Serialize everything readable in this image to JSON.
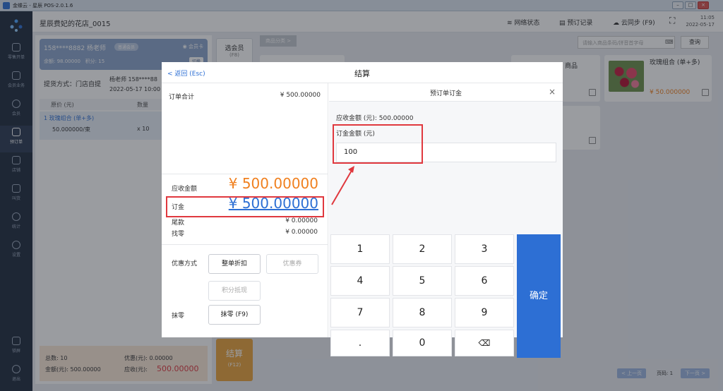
{
  "window": {
    "title": "金蝶云 - 星辰 POS-2.0.1.6"
  },
  "sidebar": {
    "items": [
      {
        "label": "零售开单"
      },
      {
        "label": "会员业务"
      },
      {
        "label": "会员"
      },
      {
        "label": "预订单"
      },
      {
        "label": "店铺"
      },
      {
        "label": "叫货"
      },
      {
        "label": "统计"
      },
      {
        "label": "设置"
      },
      {
        "label": "锁屏"
      },
      {
        "label": "退出"
      }
    ]
  },
  "topbar": {
    "store": "星辰费妃的花店_0015",
    "network": "网络状态",
    "reserve": "预订记录",
    "sync": "云同步 (F9)",
    "time": "11:05",
    "date": "2022-05-17"
  },
  "member": {
    "name": "158****8882  杨老师",
    "badge": "普通会员",
    "card": "会员卡",
    "balance": "余额: 98.00000",
    "points": "积分: 15",
    "switch": "切换"
  },
  "order": {
    "delivery": "提货方式：门店自提",
    "teacher": "杨老师  158****88",
    "datetime": "2022-05-17 10:00",
    "col_price": "原价 (元)",
    "col_qty": "数量",
    "item_name": "1  玫瑰组合 (单+多)",
    "item_price": "50.000000/束",
    "item_qty": "x 10"
  },
  "summary": {
    "total_count": "总数:  10",
    "discount": "优惠(元):  0.00000",
    "amount": "金额(元):  500.00000",
    "receivable_label": "应收(元):",
    "receivable": "500.00000"
  },
  "buttons": {
    "select_member": "选会员",
    "select_member_key": "(F8)",
    "settle": "结算",
    "settle_key": "(F12)"
  },
  "catalog": {
    "category": "商品分类  >",
    "search_placeholder": "请输入商品条码/拼音首字母",
    "query": "查询",
    "product1_name": "商品",
    "product2_name": "玫瑰组合 (单+多)",
    "product2_price": "¥ 50.000000",
    "prev": "< 上一页",
    "page": "页码: 1",
    "next": "下一页 >"
  },
  "dialog": {
    "back": "< 返回 (Esc)",
    "title": "结算",
    "order_total_label": "订单合计",
    "order_total": "¥ 500.00000",
    "receivable_label": "应收金额",
    "receivable": "¥ 500.00000",
    "deposit_label": "订金",
    "deposit": "¥ 500.00000",
    "balance_label": "尾款",
    "balance": "¥ 0.00000",
    "change_label": "找零",
    "change": "¥ 0.00000",
    "discount_label": "优惠方式",
    "whole_discount": "整单折扣",
    "coupon": "优惠券",
    "points_offset": "积分抵现",
    "rounding_label": "抹零",
    "rounding_btn": "抹零 (F9)"
  },
  "deposit_panel": {
    "title": "预订单订金",
    "close": "×",
    "due": "应收金额 (元): 500.00000",
    "amount_label": "订金金额 (元)",
    "amount_value": "100"
  },
  "keypad": {
    "k1": "1",
    "k2": "2",
    "k3": "3",
    "k4": "4",
    "k5": "5",
    "k6": "6",
    "k7": "7",
    "k8": "8",
    "k9": "9",
    "kdot": ".",
    "k0": "0",
    "kdel": "⌫",
    "confirm": "确定"
  },
  "colors": {
    "accent": "#2d6fd4",
    "orange": "#f0801f",
    "highlight": "#e0383e"
  }
}
